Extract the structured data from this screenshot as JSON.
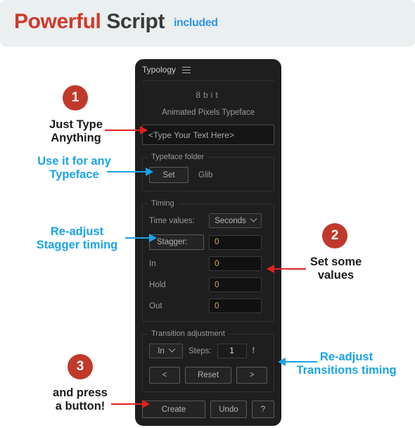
{
  "banner": {
    "word1": "Powerful",
    "word2": "Script",
    "word3": "included",
    "color_word1": "#cf3a2b",
    "color_word2": "#3a3a3a",
    "color_word3": "#2f95e8"
  },
  "panel": {
    "title": "Typology",
    "menu_icon": "hamburger-icon",
    "headline": "8bit",
    "subtitle": "Animated Pixels Typeface",
    "text_input_value": "<Type Your Text Here>",
    "typeface_group": {
      "legend": "Typeface folder",
      "set_button": "Set",
      "folder_name": "Glib"
    },
    "timing_group": {
      "legend": "Timing",
      "time_values_label": "Time values:",
      "time_values_selected": "Seconds",
      "rows": [
        {
          "label": "Stagger:",
          "value": "0",
          "is_button": true
        },
        {
          "label": "In",
          "value": "0",
          "is_button": false
        },
        {
          "label": "Hold",
          "value": "0",
          "is_button": false
        },
        {
          "label": "Out",
          "value": "0",
          "is_button": false
        }
      ]
    },
    "transition_group": {
      "legend": "Transition adjustment",
      "direction_selected": "In",
      "steps_label": "Steps:",
      "steps_value": "1",
      "steps_unit": "f",
      "prev_button": "<",
      "reset_button": "Reset",
      "next_button": ">"
    },
    "bottom_buttons": {
      "create": "Create",
      "undo": "Undo",
      "help": "?"
    }
  },
  "annotations": {
    "badge1": "1",
    "badge2": "2",
    "badge3": "3",
    "note1": "Just Type\nAnything",
    "note2": "Use it for any\nTypeface",
    "note3": "Re-adjust\nStagger timing",
    "note4": "Set some\nvalues",
    "note5": "Re-adjust\nTransitions timing",
    "note6": "and press\na button!",
    "accent_red": "#c0392b",
    "accent_blue": "#1aa3e8",
    "arrow_red": "#e02020"
  }
}
